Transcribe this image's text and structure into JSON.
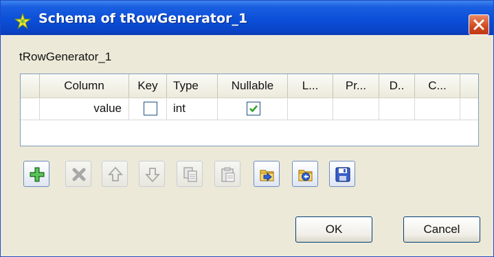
{
  "window": {
    "title": "Schema of tRowGenerator_1"
  },
  "component_label": "tRowGenerator_1",
  "table": {
    "headers": [
      "Column",
      "Key",
      "Type",
      "Nullable",
      "L...",
      "Pr...",
      "D..",
      "C..."
    ],
    "rows": [
      {
        "column": "value",
        "key": false,
        "type": "int",
        "nullable": true,
        "length": "",
        "precision": "",
        "default": "",
        "comment": ""
      }
    ]
  },
  "toolbar": {
    "buttons": [
      {
        "icon": "add-icon",
        "enabled": true
      },
      {
        "icon": "delete-icon",
        "enabled": false
      },
      {
        "icon": "move-up-icon",
        "enabled": false
      },
      {
        "icon": "move-down-icon",
        "enabled": false
      },
      {
        "icon": "copy-icon",
        "enabled": false
      },
      {
        "icon": "paste-icon",
        "enabled": false
      },
      {
        "icon": "import-icon",
        "enabled": true
      },
      {
        "icon": "export-icon",
        "enabled": true
      },
      {
        "icon": "save-icon",
        "enabled": true
      }
    ]
  },
  "buttons": {
    "ok": "OK",
    "cancel": "Cancel"
  },
  "colors": {
    "titlebar": "#0b4fd8",
    "close": "#d14a1c",
    "add": "#2e9a2e",
    "checkmark": "#2aa12a"
  }
}
